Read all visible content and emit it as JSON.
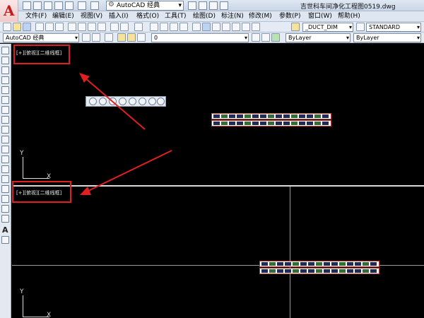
{
  "app": {
    "logo_letter": "A",
    "workspace": "AutoCAD 经典",
    "title": "吉世科车间净化工程图0519.dwg"
  },
  "menu": [
    "文件(F)",
    "编辑(E)",
    "视图(V)",
    "插入(I)",
    "格式(O)",
    "工具(T)",
    "绘图(D)",
    "标注(N)",
    "修改(M)",
    "参数(P)",
    "窗口(W)",
    "帮助(H)"
  ],
  "toolbar2": {
    "dimstyle": "_DUCT_DIM",
    "textstyle": "STANDARD"
  },
  "toolbar3": {
    "workspace": "AutoCAD 经典",
    "layer": "0",
    "color": "ByLayer",
    "linetype": "ByLayer"
  },
  "left_toolbar": {
    "text_tool": "A"
  },
  "viewports": {
    "top_label": "[+][俯视][二维线框]",
    "bottom_label": "[+][俯视][二维线框]",
    "ucs_y": "Y",
    "ucs_x": "X"
  },
  "annotation_colors": {
    "highlight": "#e02020",
    "arrow": "#e02020"
  }
}
